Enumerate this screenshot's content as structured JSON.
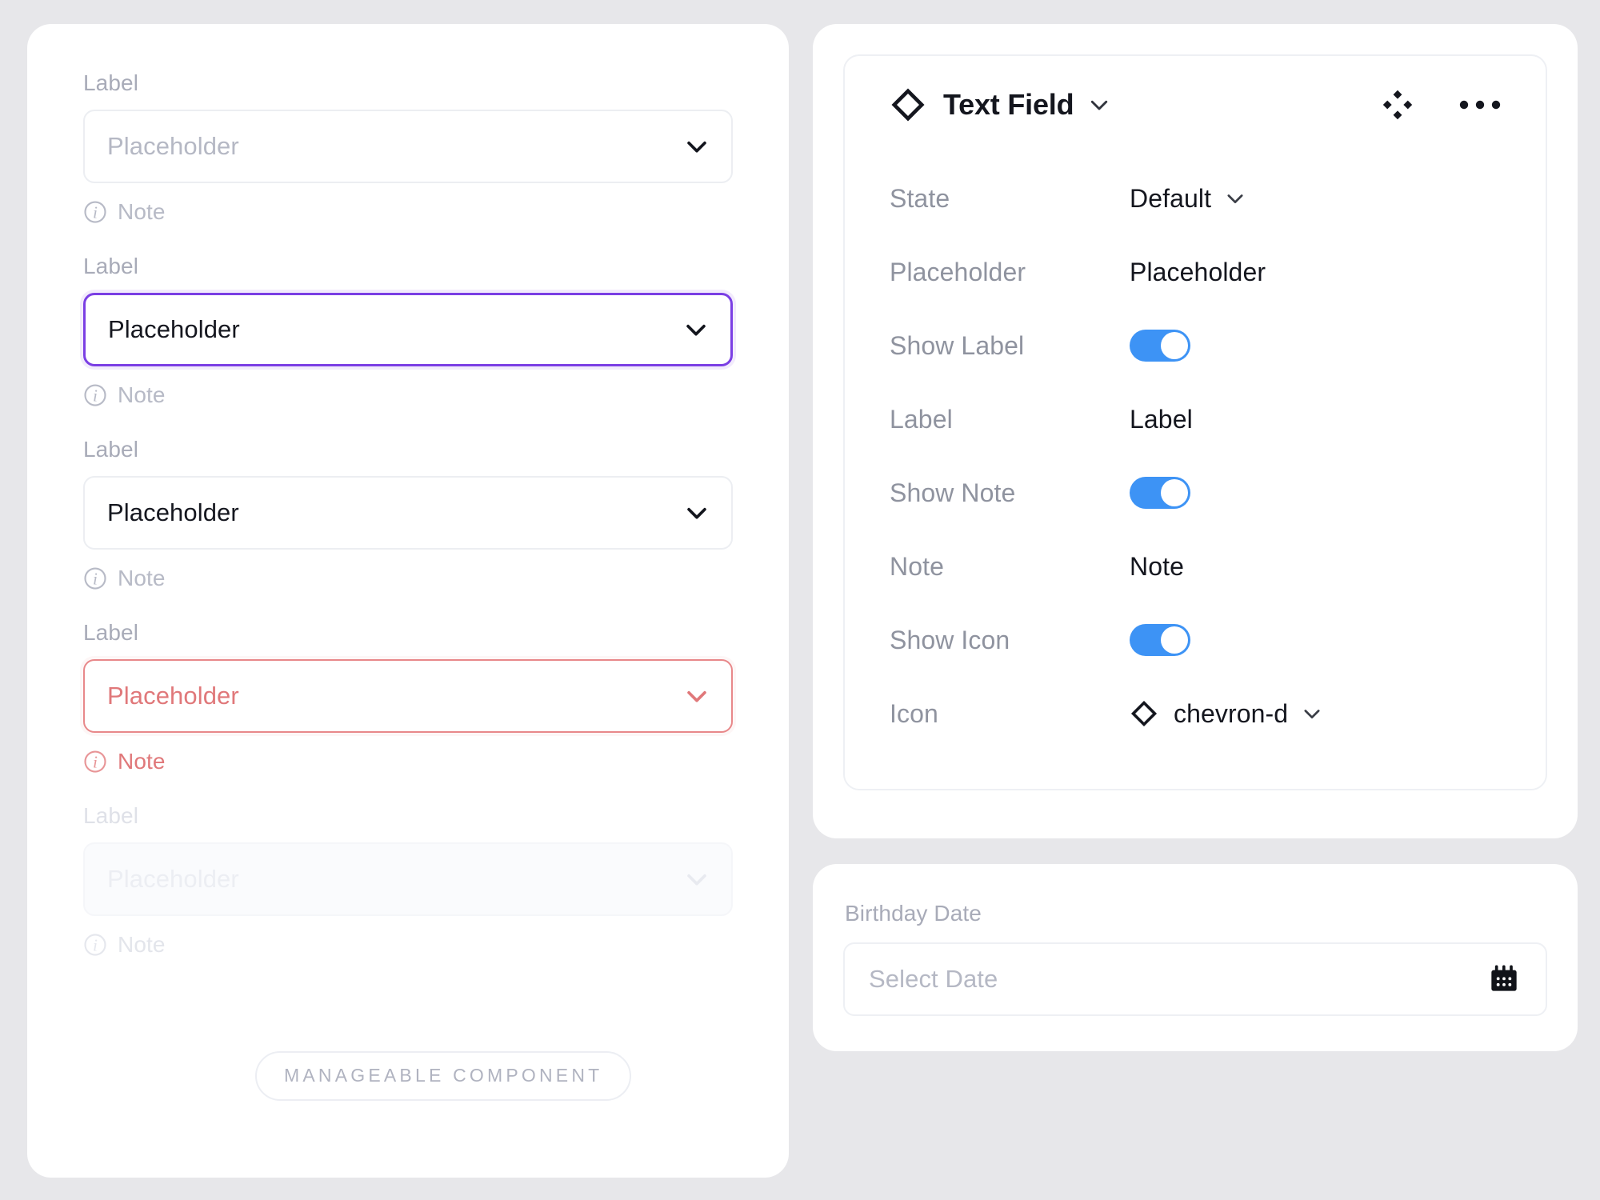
{
  "left_panel": {
    "badge_label": "MANAGEABLE COMPONENT",
    "fields": [
      {
        "label": "Label",
        "placeholder": "Placeholder",
        "note": "Note",
        "state": "default"
      },
      {
        "label": "Label",
        "placeholder": "Placeholder",
        "note": "Note",
        "state": "focused"
      },
      {
        "label": "Label",
        "placeholder": "Placeholder",
        "note": "Note",
        "state": "filled"
      },
      {
        "label": "Label",
        "placeholder": "Placeholder",
        "note": "Note",
        "state": "error"
      },
      {
        "label": "Label",
        "placeholder": "Placeholder",
        "note": "Note",
        "state": "disabled"
      }
    ]
  },
  "inspector": {
    "component_icon": "diamond-icon",
    "component_name": "Text Field",
    "header_chevron_icon": "chevron-down-icon",
    "swap_icon": "four-diamonds-icon",
    "more_icon": "more-horizontal-icon",
    "properties": [
      {
        "name": "State",
        "type": "select",
        "value": "Default"
      },
      {
        "name": "Placeholder",
        "type": "text",
        "value": "Placeholder"
      },
      {
        "name": "Show Label",
        "type": "toggle",
        "value": "on"
      },
      {
        "name": "Label",
        "type": "text",
        "value": "Label"
      },
      {
        "name": "Show Note",
        "type": "toggle",
        "value": "on"
      },
      {
        "name": "Note",
        "type": "text",
        "value": "Note"
      },
      {
        "name": "Show Icon",
        "type": "toggle",
        "value": "on"
      },
      {
        "name": "Icon",
        "type": "icon-select",
        "value": "chevron-d"
      }
    ]
  },
  "date_card": {
    "label": "Birthday Date",
    "placeholder": "Select Date",
    "icon": "calendar-icon"
  },
  "colors": {
    "background": "#e7e7ea",
    "card": "#ffffff",
    "muted_text": "#a8abb8",
    "focus_border": "#7b3fe4",
    "error": "#e0787a",
    "toggle_on": "#3d93f5",
    "primary_text": "#14161e"
  }
}
